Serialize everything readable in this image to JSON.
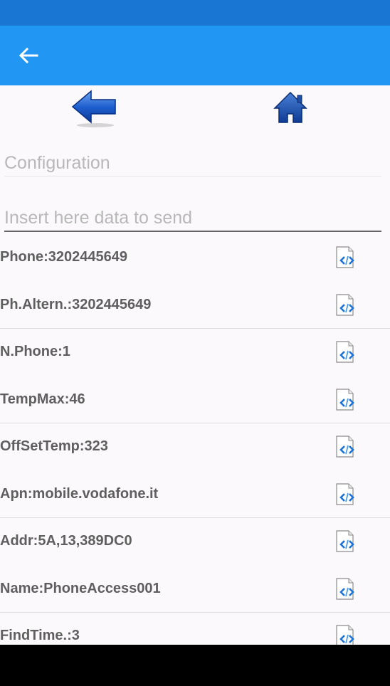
{
  "colors": {
    "status_bar": "#1976D2",
    "app_bar": "#2196F3",
    "content_bg": "#FCF9FC",
    "label_text": "#5F5F5F",
    "hint_text": "#B8B8B8"
  },
  "app_bar": {
    "back_icon": "arrow-back-icon"
  },
  "toolbar": {
    "back_icon": "blue-left-arrow-icon",
    "home_icon": "home-icon"
  },
  "config_field": {
    "placeholder": "Configuration"
  },
  "data_field": {
    "placeholder": "Insert here data to send"
  },
  "items": [
    {
      "label": "Phone:3202445649",
      "icon": "send-code-icon"
    },
    {
      "label": "Ph.Altern.:3202445649",
      "icon": "send-code-icon"
    },
    {
      "label": "N.Phone:1",
      "icon": "send-code-icon"
    },
    {
      "label": "TempMax:46",
      "icon": "send-code-icon"
    },
    {
      "label": "OffSetTemp:323",
      "icon": "send-code-icon"
    },
    {
      "label": "Apn:mobile.vodafone.it",
      "icon": "send-code-icon"
    },
    {
      "label": "Addr:5A,13,389DC0",
      "icon": "send-code-icon"
    },
    {
      "label": "Name:PhoneAccess001",
      "icon": "send-code-icon"
    },
    {
      "label": "FindTime.:3",
      "icon": "send-code-icon"
    }
  ]
}
